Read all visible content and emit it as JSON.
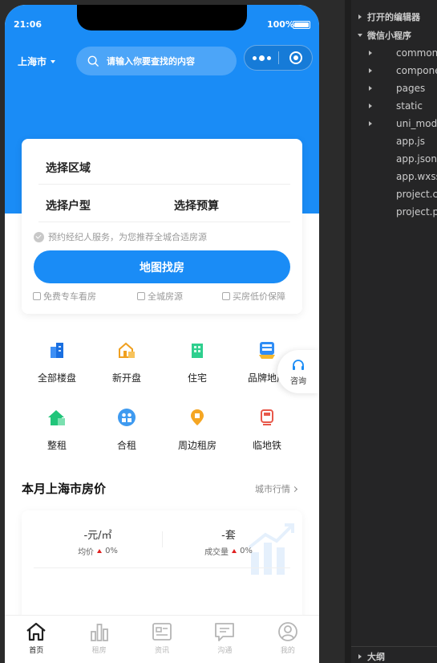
{
  "status_bar": {
    "time": "21:06",
    "battery": "100%"
  },
  "header": {
    "city": "上海市",
    "search_placeholder": "请输入你要查找的内容"
  },
  "search_card": {
    "area": "选择区域",
    "layout": "选择户型",
    "budget": "选择预算",
    "agent_notice": "预约经纪人服务，为您推荐全城合适房源",
    "map_button": "地图找房",
    "features": [
      "免费专车看房",
      "全城房源",
      "买房低价保障"
    ]
  },
  "categories": [
    {
      "label": "全部楼盘",
      "icon": "buildings-icon"
    },
    {
      "label": "新开盘",
      "icon": "new-house-icon"
    },
    {
      "label": "住宅",
      "icon": "residence-icon"
    },
    {
      "label": "品牌地产",
      "icon": "brand-icon"
    },
    {
      "label": "整租",
      "icon": "whole-rent-icon"
    },
    {
      "label": "合租",
      "icon": "shared-rent-icon"
    },
    {
      "label": "周边租房",
      "icon": "nearby-icon"
    },
    {
      "label": "临地铁",
      "icon": "subway-icon"
    }
  ],
  "consult": {
    "label": "咨询"
  },
  "price_section": {
    "title": "本月上海市房价",
    "link": "城市行情",
    "stats": [
      {
        "value": "-元/㎡",
        "label": "均价",
        "change": "0%"
      },
      {
        "value": "-套",
        "label": "成交量",
        "change": "0%"
      }
    ]
  },
  "tabbar": [
    {
      "label": "首页",
      "icon": "home-icon",
      "active": true
    },
    {
      "label": "租房",
      "icon": "bar-chart-icon",
      "active": false
    },
    {
      "label": "资讯",
      "icon": "news-icon",
      "active": false
    },
    {
      "label": "沟通",
      "icon": "chat-icon",
      "active": false
    },
    {
      "label": "我的",
      "icon": "user-icon",
      "active": false
    }
  ],
  "ide": {
    "open_editors": "打开的编辑器",
    "project": "微信小程序",
    "items": [
      "common",
      "components",
      "pages",
      "static",
      "uni_modules",
      "app.js",
      "app.json",
      "app.wxss",
      "project.config.json",
      "project.private.config.json"
    ],
    "outline": "大纲"
  },
  "colors": {
    "primary": "#1a8cf6",
    "up": "#e02020"
  }
}
